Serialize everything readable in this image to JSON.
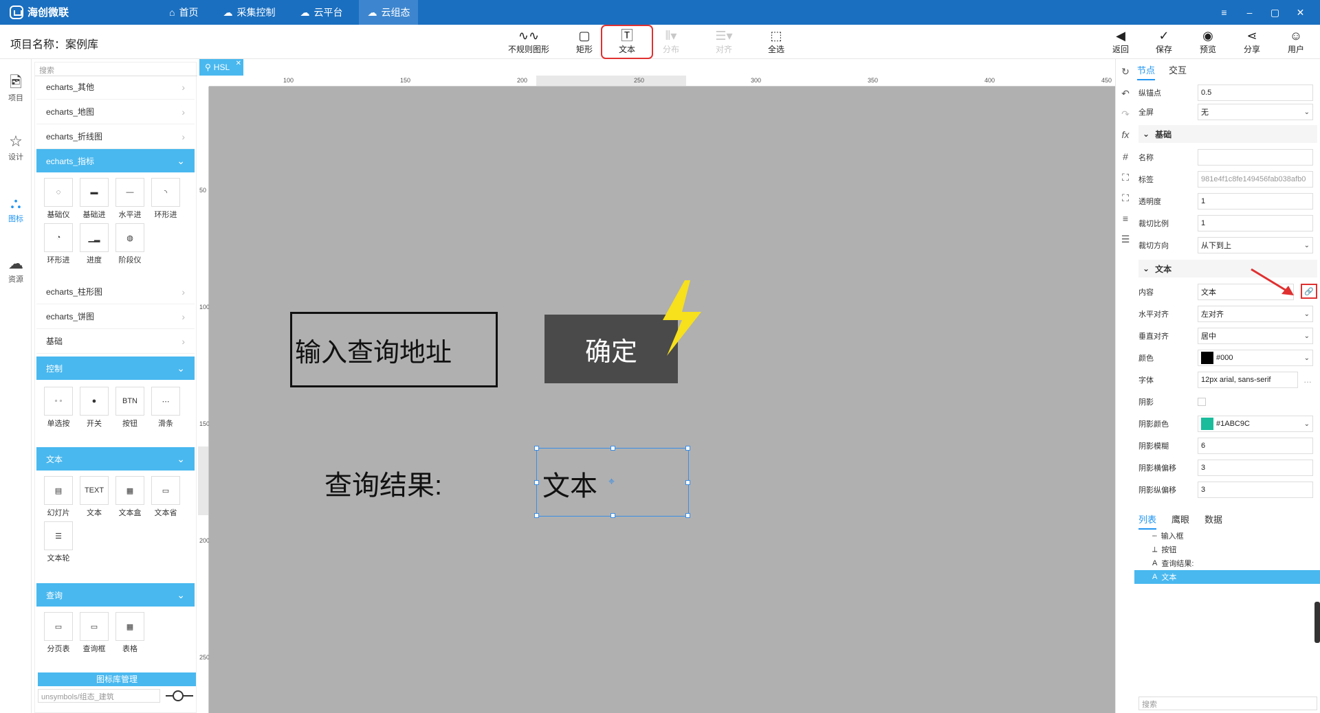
{
  "app": {
    "name": "海创微联"
  },
  "nav": {
    "tabs": [
      {
        "label": "首页",
        "icon": "home-icon"
      },
      {
        "label": "采集控制",
        "icon": "cloud-data-icon"
      },
      {
        "label": "云平台",
        "icon": "cloud-platform-icon"
      },
      {
        "label": "云组态",
        "icon": "cloud-config-icon"
      }
    ]
  },
  "toolbar": {
    "project": "项目名称：案例库",
    "tools": [
      "不规则图形",
      "矩形",
      "文本",
      "分布",
      "对齐",
      "全选"
    ],
    "right_tools": [
      "返回",
      "保存",
      "预览",
      "分享",
      "用户"
    ]
  },
  "rail": {
    "items": [
      "项目",
      "设计",
      "图标",
      "资源"
    ]
  },
  "panel": {
    "search_placeholder": "搜索",
    "collapsed": [
      "echarts_其他",
      "echarts_地图",
      "echarts_折线图"
    ],
    "open1": "echarts_指标",
    "open1_items": [
      "基础仪",
      "基础进",
      "水平进",
      "环形进",
      "环形进",
      "进度",
      "阶段仪"
    ],
    "collapsed2": [
      "echarts_柱形图",
      "echarts_饼图",
      "基础"
    ],
    "open2": "控制",
    "open2_items": [
      "单选按",
      "开关",
      "按钮",
      "滑条"
    ],
    "open3": "文本",
    "open3_items": [
      "幻灯片",
      "文本",
      "文本盒",
      "文本省",
      "文本轮"
    ],
    "open4": "查询",
    "open4_items": [
      "分页表",
      "查询框",
      "表格"
    ],
    "lib_button": "图标库管理",
    "lib_value": "unsymbols/组态_建筑",
    "thumb_texts": {
      "btn": "BTN",
      "text": "TEXT"
    }
  },
  "doc": {
    "tab": "HSL"
  },
  "ruler": {
    "top": [
      "100",
      "150",
      "200",
      "250",
      "300",
      "350",
      "400",
      "450"
    ],
    "left": [
      "50",
      "100",
      "150",
      "200",
      "250"
    ]
  },
  "canvas": {
    "input_text": "输入查询地址",
    "button_text": "确定",
    "label_text": "查询结果:",
    "text_widget": "文本"
  },
  "props": {
    "tabs": [
      "节点",
      "交互"
    ],
    "rows_top": [
      {
        "label": "纵锚点",
        "value": "0.5"
      },
      {
        "label": "全屏",
        "value": "无"
      }
    ],
    "sec_basic": "基础",
    "basic": [
      {
        "label": "名称",
        "value": ""
      },
      {
        "label": "标签",
        "value": "981e4f1c8fe149456fab038afb0"
      },
      {
        "label": "透明度",
        "value": "1"
      },
      {
        "label": "裁切比例",
        "value": "1"
      },
      {
        "label": "裁切方向",
        "value": "从下到上"
      }
    ],
    "sec_text": "文本",
    "text": [
      {
        "label": "内容",
        "value": "文本"
      },
      {
        "label": "水平对齐",
        "value": "左对齐"
      },
      {
        "label": "垂直对齐",
        "value": "居中"
      },
      {
        "label": "颜色",
        "value": "#000"
      },
      {
        "label": "字体",
        "value": "12px arial, sans-serif"
      },
      {
        "label": "阴影",
        "value": ""
      },
      {
        "label": "阴影颜色",
        "value": "#1ABC9C"
      },
      {
        "label": "阴影模糊",
        "value": "6"
      },
      {
        "label": "阴影横偏移",
        "value": "3"
      },
      {
        "label": "阴影纵偏移",
        "value": "3"
      }
    ],
    "list_tabs": [
      "列表",
      "鹰眼",
      "数据"
    ],
    "tree": [
      "输入框",
      "按钮",
      "查询结果:",
      "文本"
    ],
    "search_placeholder": "搜索",
    "colors": {
      "text_color": "#000000",
      "shadow_color": "#1ABC9C"
    }
  },
  "colors": {
    "titlebar": "#1a6fc0",
    "accent": "#49b8ef",
    "canvas": "#b0b0b0",
    "highlight": "#e03030"
  }
}
